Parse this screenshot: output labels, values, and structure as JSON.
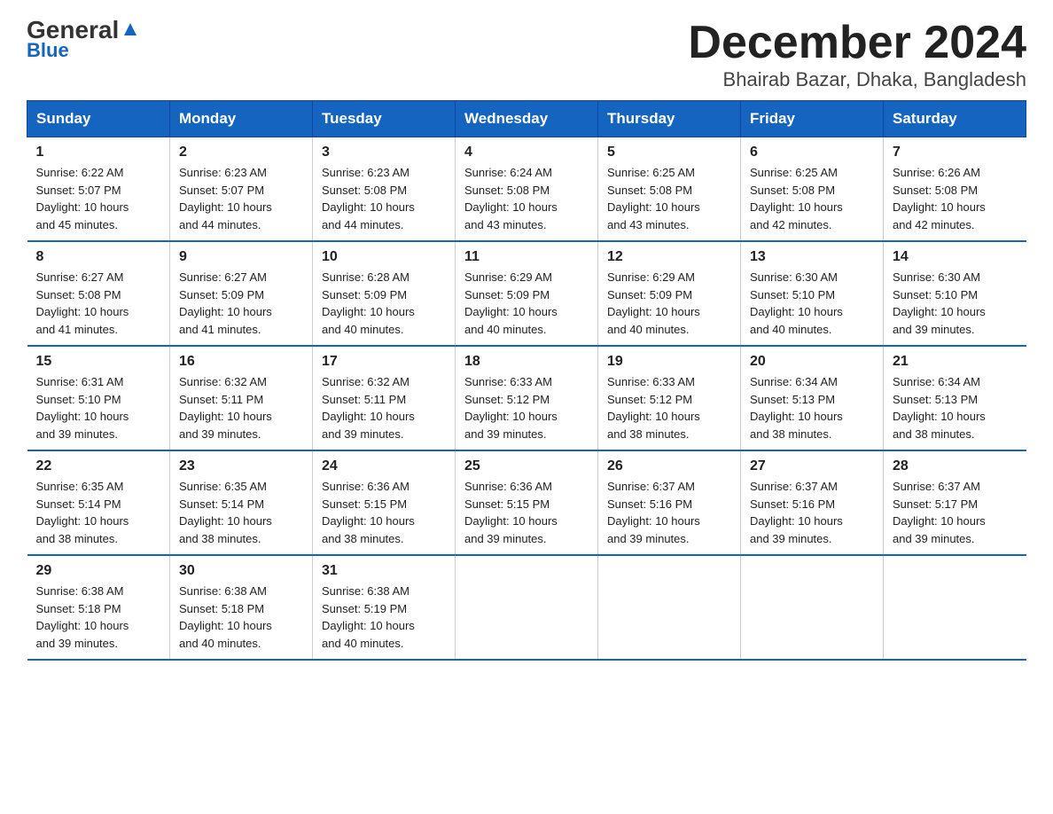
{
  "logo": {
    "general": "General",
    "blue": "Blue"
  },
  "title": {
    "month_year": "December 2024",
    "location": "Bhairab Bazar, Dhaka, Bangladesh"
  },
  "headers": [
    "Sunday",
    "Monday",
    "Tuesday",
    "Wednesday",
    "Thursday",
    "Friday",
    "Saturday"
  ],
  "weeks": [
    [
      {
        "day": "1",
        "info": "Sunrise: 6:22 AM\nSunset: 5:07 PM\nDaylight: 10 hours\nand 45 minutes."
      },
      {
        "day": "2",
        "info": "Sunrise: 6:23 AM\nSunset: 5:07 PM\nDaylight: 10 hours\nand 44 minutes."
      },
      {
        "day": "3",
        "info": "Sunrise: 6:23 AM\nSunset: 5:08 PM\nDaylight: 10 hours\nand 44 minutes."
      },
      {
        "day": "4",
        "info": "Sunrise: 6:24 AM\nSunset: 5:08 PM\nDaylight: 10 hours\nand 43 minutes."
      },
      {
        "day": "5",
        "info": "Sunrise: 6:25 AM\nSunset: 5:08 PM\nDaylight: 10 hours\nand 43 minutes."
      },
      {
        "day": "6",
        "info": "Sunrise: 6:25 AM\nSunset: 5:08 PM\nDaylight: 10 hours\nand 42 minutes."
      },
      {
        "day": "7",
        "info": "Sunrise: 6:26 AM\nSunset: 5:08 PM\nDaylight: 10 hours\nand 42 minutes."
      }
    ],
    [
      {
        "day": "8",
        "info": "Sunrise: 6:27 AM\nSunset: 5:08 PM\nDaylight: 10 hours\nand 41 minutes."
      },
      {
        "day": "9",
        "info": "Sunrise: 6:27 AM\nSunset: 5:09 PM\nDaylight: 10 hours\nand 41 minutes."
      },
      {
        "day": "10",
        "info": "Sunrise: 6:28 AM\nSunset: 5:09 PM\nDaylight: 10 hours\nand 40 minutes."
      },
      {
        "day": "11",
        "info": "Sunrise: 6:29 AM\nSunset: 5:09 PM\nDaylight: 10 hours\nand 40 minutes."
      },
      {
        "day": "12",
        "info": "Sunrise: 6:29 AM\nSunset: 5:09 PM\nDaylight: 10 hours\nand 40 minutes."
      },
      {
        "day": "13",
        "info": "Sunrise: 6:30 AM\nSunset: 5:10 PM\nDaylight: 10 hours\nand 40 minutes."
      },
      {
        "day": "14",
        "info": "Sunrise: 6:30 AM\nSunset: 5:10 PM\nDaylight: 10 hours\nand 39 minutes."
      }
    ],
    [
      {
        "day": "15",
        "info": "Sunrise: 6:31 AM\nSunset: 5:10 PM\nDaylight: 10 hours\nand 39 minutes."
      },
      {
        "day": "16",
        "info": "Sunrise: 6:32 AM\nSunset: 5:11 PM\nDaylight: 10 hours\nand 39 minutes."
      },
      {
        "day": "17",
        "info": "Sunrise: 6:32 AM\nSunset: 5:11 PM\nDaylight: 10 hours\nand 39 minutes."
      },
      {
        "day": "18",
        "info": "Sunrise: 6:33 AM\nSunset: 5:12 PM\nDaylight: 10 hours\nand 39 minutes."
      },
      {
        "day": "19",
        "info": "Sunrise: 6:33 AM\nSunset: 5:12 PM\nDaylight: 10 hours\nand 38 minutes."
      },
      {
        "day": "20",
        "info": "Sunrise: 6:34 AM\nSunset: 5:13 PM\nDaylight: 10 hours\nand 38 minutes."
      },
      {
        "day": "21",
        "info": "Sunrise: 6:34 AM\nSunset: 5:13 PM\nDaylight: 10 hours\nand 38 minutes."
      }
    ],
    [
      {
        "day": "22",
        "info": "Sunrise: 6:35 AM\nSunset: 5:14 PM\nDaylight: 10 hours\nand 38 minutes."
      },
      {
        "day": "23",
        "info": "Sunrise: 6:35 AM\nSunset: 5:14 PM\nDaylight: 10 hours\nand 38 minutes."
      },
      {
        "day": "24",
        "info": "Sunrise: 6:36 AM\nSunset: 5:15 PM\nDaylight: 10 hours\nand 38 minutes."
      },
      {
        "day": "25",
        "info": "Sunrise: 6:36 AM\nSunset: 5:15 PM\nDaylight: 10 hours\nand 39 minutes."
      },
      {
        "day": "26",
        "info": "Sunrise: 6:37 AM\nSunset: 5:16 PM\nDaylight: 10 hours\nand 39 minutes."
      },
      {
        "day": "27",
        "info": "Sunrise: 6:37 AM\nSunset: 5:16 PM\nDaylight: 10 hours\nand 39 minutes."
      },
      {
        "day": "28",
        "info": "Sunrise: 6:37 AM\nSunset: 5:17 PM\nDaylight: 10 hours\nand 39 minutes."
      }
    ],
    [
      {
        "day": "29",
        "info": "Sunrise: 6:38 AM\nSunset: 5:18 PM\nDaylight: 10 hours\nand 39 minutes."
      },
      {
        "day": "30",
        "info": "Sunrise: 6:38 AM\nSunset: 5:18 PM\nDaylight: 10 hours\nand 40 minutes."
      },
      {
        "day": "31",
        "info": "Sunrise: 6:38 AM\nSunset: 5:19 PM\nDaylight: 10 hours\nand 40 minutes."
      },
      {
        "day": "",
        "info": ""
      },
      {
        "day": "",
        "info": ""
      },
      {
        "day": "",
        "info": ""
      },
      {
        "day": "",
        "info": ""
      }
    ]
  ]
}
